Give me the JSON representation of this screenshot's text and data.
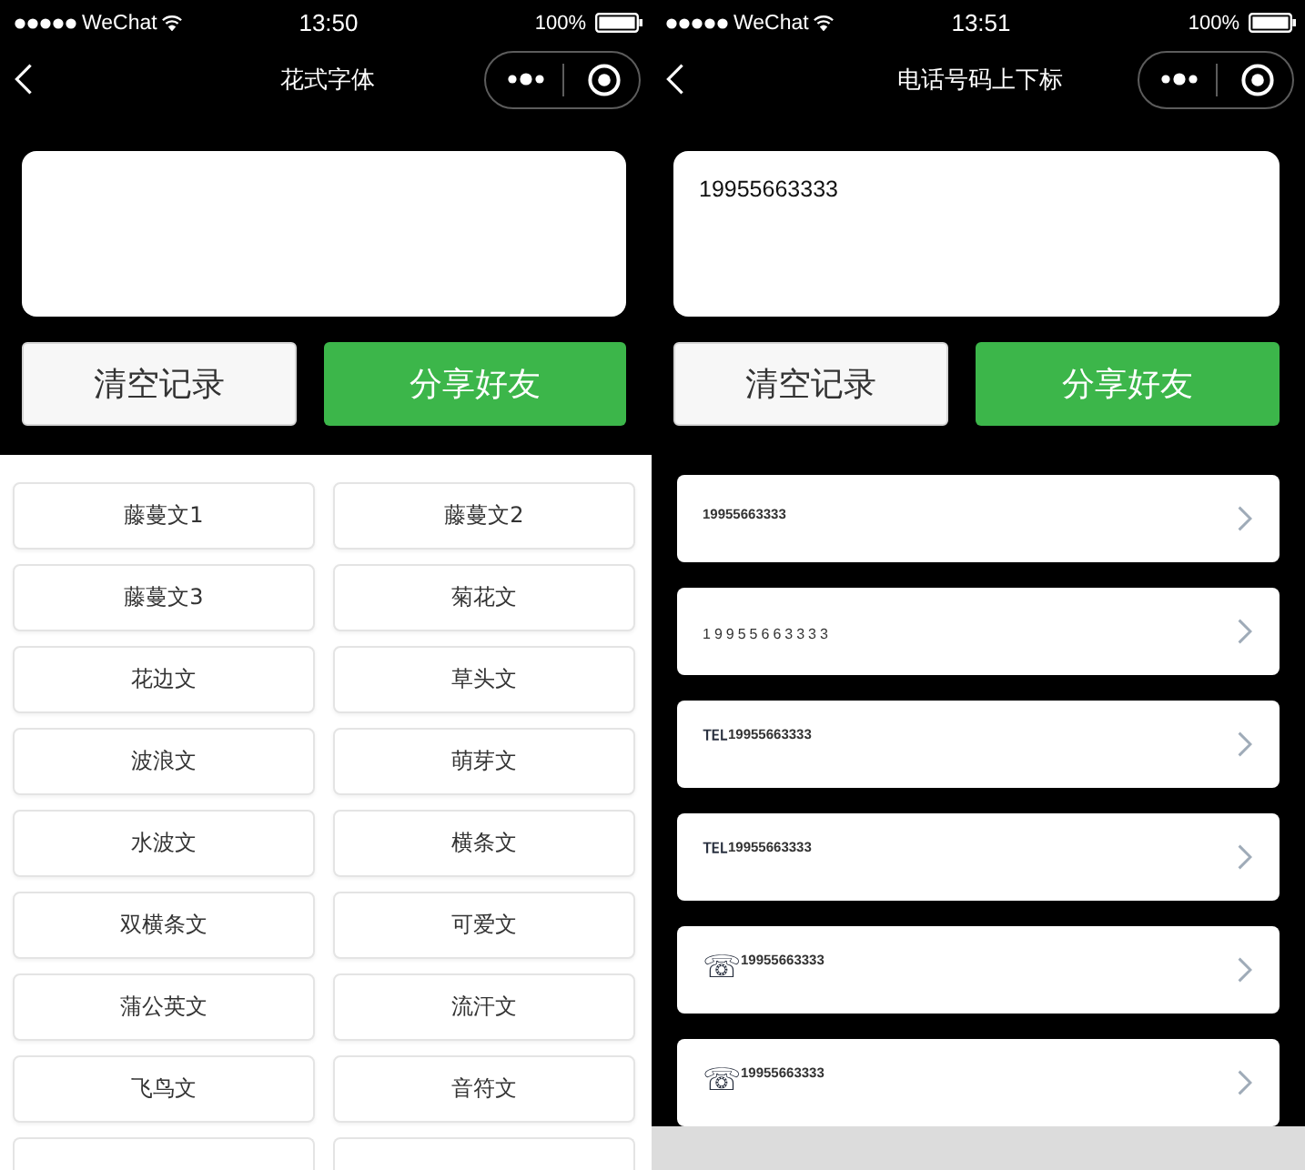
{
  "screens": [
    {
      "kind": "grid",
      "status_bar": {
        "carrier": "WeChat",
        "time": "13:50",
        "battery": "100%"
      },
      "nav": {
        "title": "花式字体"
      },
      "buttons": [
        {
          "label": "清空记录",
          "kind": "secondary"
        },
        {
          "label": "分享好友",
          "kind": "primary"
        }
      ],
      "items": [
        {
          "label": "藤蔓文1"
        },
        {
          "label": "藤蔓文2"
        },
        {
          "label": "藤蔓文3"
        },
        {
          "label": "菊花文"
        },
        {
          "label": "花边文"
        },
        {
          "label": "草头文"
        },
        {
          "label": "波浪文"
        },
        {
          "label": "萌芽文"
        },
        {
          "label": "水波文"
        },
        {
          "label": "横条文"
        },
        {
          "label": "双横条文"
        },
        {
          "label": "可爱文"
        },
        {
          "label": "蒲公英文"
        },
        {
          "label": "流汗文"
        },
        {
          "label": "飞鸟文"
        },
        {
          "label": "音符文"
        }
      ],
      "more_below": true
    },
    {
      "kind": "list",
      "status_bar": {
        "carrier": "WeChat",
        "time": "13:51",
        "battery": "100%"
      },
      "nav": {
        "title": "电话号码上下标"
      },
      "input": {
        "value": "19955663333"
      },
      "buttons": [
        {
          "label": "清空记录",
          "kind": "secondary"
        },
        {
          "label": "分享好友",
          "kind": "primary"
        }
      ],
      "items": [
        {
          "text": "19955663333",
          "kind": "raised"
        },
        {
          "text": "19955663333",
          "kind": "spaced"
        },
        {
          "text": "℡$^{19955663333}$",
          "kind": "prefixed"
        },
        {
          "text": "℡$^{19955663333}$",
          "kind": "prefixed"
        },
        {
          "text": "☏$^{19955663333}$",
          "kind": "prefixed"
        },
        {
          "text": "☏$^{19955663333}$",
          "kind": "prefixed"
        }
      ],
      "bottom_bar": true
    }
  ]
}
